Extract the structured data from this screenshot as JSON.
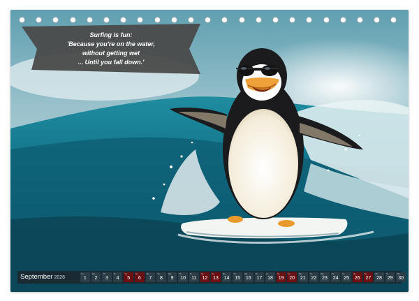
{
  "quote": {
    "lines": [
      "Surfing is fun:",
      "'Because you're on the water,",
      "without getting wet",
      "... Until you fall down.'"
    ]
  },
  "calendar": {
    "month": "September",
    "year": "2026",
    "days": [
      {
        "n": "1",
        "wd": "Tu",
        "weekend": false
      },
      {
        "n": "2",
        "wd": "We",
        "weekend": false
      },
      {
        "n": "3",
        "wd": "Th",
        "weekend": false
      },
      {
        "n": "4",
        "wd": "Fr",
        "weekend": false
      },
      {
        "n": "5",
        "wd": "Sa",
        "weekend": true
      },
      {
        "n": "6",
        "wd": "Su",
        "weekend": true
      },
      {
        "n": "7",
        "wd": "Mo",
        "weekend": false
      },
      {
        "n": "8",
        "wd": "Tu",
        "weekend": false
      },
      {
        "n": "9",
        "wd": "We",
        "weekend": false
      },
      {
        "n": "10",
        "wd": "Th",
        "weekend": false
      },
      {
        "n": "11",
        "wd": "Fr",
        "weekend": false
      },
      {
        "n": "12",
        "wd": "Sa",
        "weekend": true
      },
      {
        "n": "13",
        "wd": "Su",
        "weekend": true
      },
      {
        "n": "14",
        "wd": "Mo",
        "weekend": false
      },
      {
        "n": "15",
        "wd": "Tu",
        "weekend": false
      },
      {
        "n": "16",
        "wd": "We",
        "weekend": false
      },
      {
        "n": "17",
        "wd": "Th",
        "weekend": false
      },
      {
        "n": "18",
        "wd": "Fr",
        "weekend": false
      },
      {
        "n": "19",
        "wd": "Sa",
        "weekend": true
      },
      {
        "n": "20",
        "wd": "Su",
        "weekend": true
      },
      {
        "n": "21",
        "wd": "Mo",
        "weekend": false
      },
      {
        "n": "22",
        "wd": "Tu",
        "weekend": false
      },
      {
        "n": "23",
        "wd": "We",
        "weekend": false
      },
      {
        "n": "24",
        "wd": "Th",
        "weekend": false
      },
      {
        "n": "25",
        "wd": "Fr",
        "weekend": false
      },
      {
        "n": "26",
        "wd": "Sa",
        "weekend": true
      },
      {
        "n": "27",
        "wd": "Su",
        "weekend": true
      },
      {
        "n": "28",
        "wd": "Mo",
        "weekend": false
      },
      {
        "n": "29",
        "wd": "Tu",
        "weekend": false
      },
      {
        "n": "30",
        "wd": "We",
        "weekend": false
      }
    ]
  },
  "colors": {
    "bar": "#1a2a33",
    "weekday_cell": "#2b3d47",
    "weekend_cell": "#6b0f12",
    "banner": "#4a4a4a"
  }
}
